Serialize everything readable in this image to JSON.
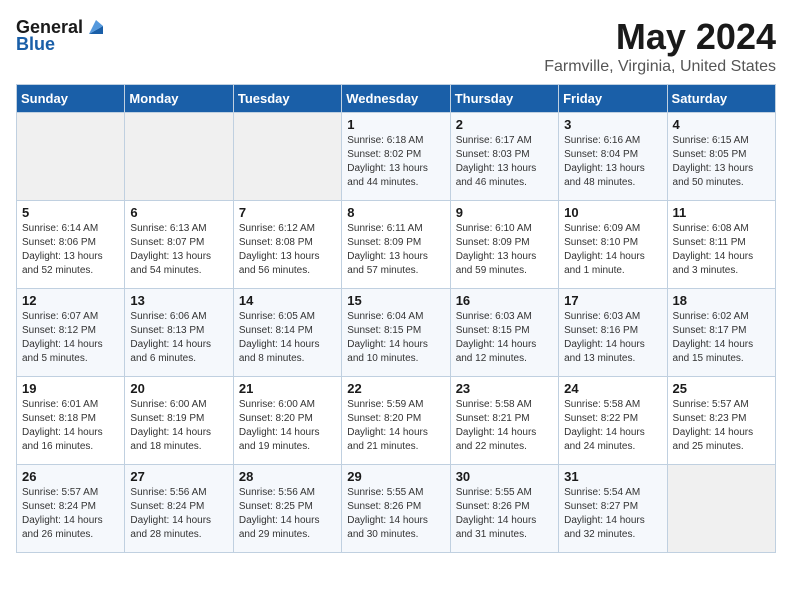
{
  "header": {
    "logo_general": "General",
    "logo_blue": "Blue",
    "title": "May 2024",
    "subtitle": "Farmville, Virginia, United States"
  },
  "days_of_week": [
    "Sunday",
    "Monday",
    "Tuesday",
    "Wednesday",
    "Thursday",
    "Friday",
    "Saturday"
  ],
  "weeks": [
    [
      {
        "day": "",
        "empty": true
      },
      {
        "day": "",
        "empty": true
      },
      {
        "day": "",
        "empty": true
      },
      {
        "day": "1",
        "sunrise": "6:18 AM",
        "sunset": "8:02 PM",
        "daylight": "13 hours and 44 minutes."
      },
      {
        "day": "2",
        "sunrise": "6:17 AM",
        "sunset": "8:03 PM",
        "daylight": "13 hours and 46 minutes."
      },
      {
        "day": "3",
        "sunrise": "6:16 AM",
        "sunset": "8:04 PM",
        "daylight": "13 hours and 48 minutes."
      },
      {
        "day": "4",
        "sunrise": "6:15 AM",
        "sunset": "8:05 PM",
        "daylight": "13 hours and 50 minutes."
      }
    ],
    [
      {
        "day": "5",
        "sunrise": "6:14 AM",
        "sunset": "8:06 PM",
        "daylight": "13 hours and 52 minutes."
      },
      {
        "day": "6",
        "sunrise": "6:13 AM",
        "sunset": "8:07 PM",
        "daylight": "13 hours and 54 minutes."
      },
      {
        "day": "7",
        "sunrise": "6:12 AM",
        "sunset": "8:08 PM",
        "daylight": "13 hours and 56 minutes."
      },
      {
        "day": "8",
        "sunrise": "6:11 AM",
        "sunset": "8:09 PM",
        "daylight": "13 hours and 57 minutes."
      },
      {
        "day": "9",
        "sunrise": "6:10 AM",
        "sunset": "8:09 PM",
        "daylight": "13 hours and 59 minutes."
      },
      {
        "day": "10",
        "sunrise": "6:09 AM",
        "sunset": "8:10 PM",
        "daylight": "14 hours and 1 minute."
      },
      {
        "day": "11",
        "sunrise": "6:08 AM",
        "sunset": "8:11 PM",
        "daylight": "14 hours and 3 minutes."
      }
    ],
    [
      {
        "day": "12",
        "sunrise": "6:07 AM",
        "sunset": "8:12 PM",
        "daylight": "14 hours and 5 minutes."
      },
      {
        "day": "13",
        "sunrise": "6:06 AM",
        "sunset": "8:13 PM",
        "daylight": "14 hours and 6 minutes."
      },
      {
        "day": "14",
        "sunrise": "6:05 AM",
        "sunset": "8:14 PM",
        "daylight": "14 hours and 8 minutes."
      },
      {
        "day": "15",
        "sunrise": "6:04 AM",
        "sunset": "8:15 PM",
        "daylight": "14 hours and 10 minutes."
      },
      {
        "day": "16",
        "sunrise": "6:03 AM",
        "sunset": "8:15 PM",
        "daylight": "14 hours and 12 minutes."
      },
      {
        "day": "17",
        "sunrise": "6:03 AM",
        "sunset": "8:16 PM",
        "daylight": "14 hours and 13 minutes."
      },
      {
        "day": "18",
        "sunrise": "6:02 AM",
        "sunset": "8:17 PM",
        "daylight": "14 hours and 15 minutes."
      }
    ],
    [
      {
        "day": "19",
        "sunrise": "6:01 AM",
        "sunset": "8:18 PM",
        "daylight": "14 hours and 16 minutes."
      },
      {
        "day": "20",
        "sunrise": "6:00 AM",
        "sunset": "8:19 PM",
        "daylight": "14 hours and 18 minutes."
      },
      {
        "day": "21",
        "sunrise": "6:00 AM",
        "sunset": "8:20 PM",
        "daylight": "14 hours and 19 minutes."
      },
      {
        "day": "22",
        "sunrise": "5:59 AM",
        "sunset": "8:20 PM",
        "daylight": "14 hours and 21 minutes."
      },
      {
        "day": "23",
        "sunrise": "5:58 AM",
        "sunset": "8:21 PM",
        "daylight": "14 hours and 22 minutes."
      },
      {
        "day": "24",
        "sunrise": "5:58 AM",
        "sunset": "8:22 PM",
        "daylight": "14 hours and 24 minutes."
      },
      {
        "day": "25",
        "sunrise": "5:57 AM",
        "sunset": "8:23 PM",
        "daylight": "14 hours and 25 minutes."
      }
    ],
    [
      {
        "day": "26",
        "sunrise": "5:57 AM",
        "sunset": "8:24 PM",
        "daylight": "14 hours and 26 minutes."
      },
      {
        "day": "27",
        "sunrise": "5:56 AM",
        "sunset": "8:24 PM",
        "daylight": "14 hours and 28 minutes."
      },
      {
        "day": "28",
        "sunrise": "5:56 AM",
        "sunset": "8:25 PM",
        "daylight": "14 hours and 29 minutes."
      },
      {
        "day": "29",
        "sunrise": "5:55 AM",
        "sunset": "8:26 PM",
        "daylight": "14 hours and 30 minutes."
      },
      {
        "day": "30",
        "sunrise": "5:55 AM",
        "sunset": "8:26 PM",
        "daylight": "14 hours and 31 minutes."
      },
      {
        "day": "31",
        "sunrise": "5:54 AM",
        "sunset": "8:27 PM",
        "daylight": "14 hours and 32 minutes."
      },
      {
        "day": "",
        "empty": true
      }
    ]
  ]
}
